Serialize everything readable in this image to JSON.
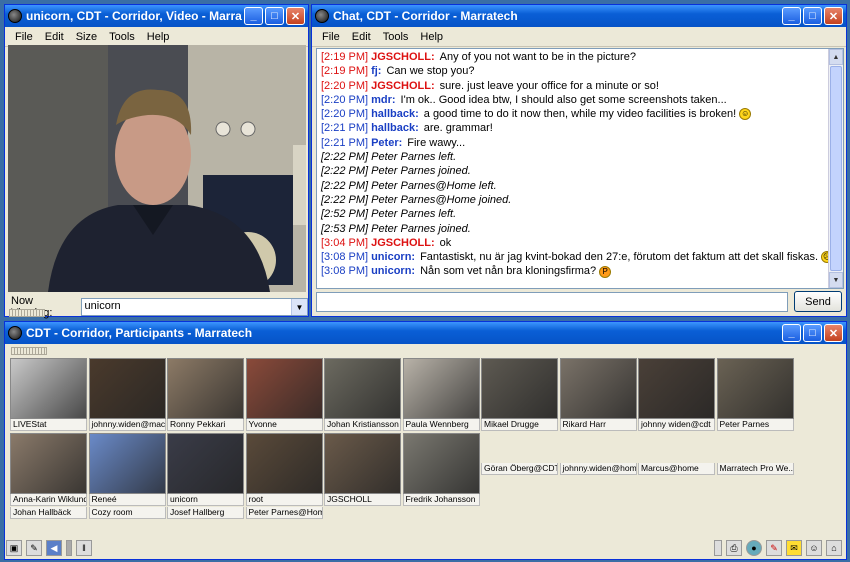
{
  "video_window": {
    "title": "unicorn, CDT - Corridor, Video - Marratech",
    "menu": [
      "File",
      "Edit",
      "Size",
      "Tools",
      "Help"
    ],
    "now_viewing_label": "Now Viewing:",
    "now_viewing_value": "unicorn"
  },
  "chat_window": {
    "title": "Chat, CDT - Corridor - Marratech",
    "menu": [
      "File",
      "Edit",
      "Tools",
      "Help"
    ],
    "send_label": "Send",
    "messages": [
      {
        "time": "[2:19 PM]",
        "time_color": "red",
        "nick": "JGSCHOLL:",
        "nick_color": "red",
        "text": "Any of you not want to be in the picture?"
      },
      {
        "time": "[2:19 PM]",
        "time_color": "red",
        "nick": "fj:",
        "nick_color": "blue",
        "text": "Can we stop you?"
      },
      {
        "time": "[2:20 PM]",
        "time_color": "red",
        "nick": "JGSCHOLL:",
        "nick_color": "red",
        "text": "sure.  just leave your office for a minute or so!"
      },
      {
        "time": "[2:20 PM]",
        "time_color": "blue",
        "nick": "mdr:",
        "nick_color": "blue",
        "text": "I'm ok.. Good idea btw, I should also get some screenshots taken..."
      },
      {
        "time": "[2:20 PM]",
        "time_color": "blue",
        "nick": "hallback:",
        "nick_color": "blue",
        "text": "a good time to do it now then, while my video facilities is broken!",
        "smiley": "smile"
      },
      {
        "time": "[2:21 PM]",
        "time_color": "blue",
        "nick": "hallback:",
        "nick_color": "blue",
        "text": "are. grammar!"
      },
      {
        "time": "[2:21 PM]",
        "time_color": "blue",
        "nick": "Peter:",
        "nick_color": "blue",
        "text": "Fire wawy..."
      },
      {
        "system": "[2:22 PM] Peter Parnes left."
      },
      {
        "system": "[2:22 PM] Peter Parnes joined."
      },
      {
        "system": "[2:22 PM] Peter Parnes@Home left."
      },
      {
        "system": "[2:22 PM] Peter Parnes@Home joined."
      },
      {
        "system": "[2:52 PM] Peter Parnes left."
      },
      {
        "system": "[2:53 PM] Peter Parnes joined."
      },
      {
        "time": "[3:04 PM]",
        "time_color": "red",
        "nick": "JGSCHOLL:",
        "nick_color": "red",
        "text": "ok"
      },
      {
        "time": "[3:08 PM]",
        "time_color": "blue",
        "nick": "unicorn:",
        "nick_color": "blue",
        "text": "Fantastiskt, nu är jag kvint-bokad den 27:e, förutom det faktum att det skall fiskas.",
        "smiley": "sad"
      },
      {
        "time": "[3:08 PM]",
        "time_color": "blue",
        "nick": "unicorn:",
        "nick_color": "blue",
        "text": "Nån som vet nån bra kloningsfirma?",
        "smiley": "tongue"
      }
    ]
  },
  "participants_window": {
    "title": "CDT - Corridor, Participants - Marratech",
    "row1": [
      {
        "name": "LIVEStat",
        "bg": "#c9c9c9"
      },
      {
        "name": "johnny.widen@mac",
        "bg": "#4a3a2c"
      },
      {
        "name": "Ronny Pekkari",
        "bg": "#8c7a66"
      },
      {
        "name": "Yvonne",
        "bg": "#8a4a3a"
      },
      {
        "name": "Johan Kristiansson",
        "bg": "#6c6a60"
      },
      {
        "name": "Paula Wennberg",
        "bg": "#b8b2a8"
      },
      {
        "name": "Mikael Drugge",
        "bg": "#5e5a52"
      },
      {
        "name": "Rikard Harr",
        "bg": "#7a7268"
      },
      {
        "name": "johnny widen@cdt",
        "bg": "#4a4038"
      },
      {
        "name": "Peter Parnes",
        "bg": "#6a6254"
      }
    ],
    "row2": [
      {
        "name": "Anna-Karin Wiklund",
        "bg": "#8a7a6a"
      },
      {
        "name": "Reneé",
        "bg": "#6a8ac8"
      },
      {
        "name": "unicorn",
        "bg": "#3a3c48"
      },
      {
        "name": "root",
        "bg": "#5a4a3a"
      },
      {
        "name": "JGSCHOLL",
        "bg": "#6a5a4a"
      },
      {
        "name": "Fredrik Johansson",
        "bg": "#7a7870"
      }
    ],
    "row2_noimg": [
      "Göran Öberg@CDT",
      "johnny.widen@home",
      "Marcus@home",
      "Marratech Pro We..."
    ],
    "row3": [
      "Johan Hallbäck",
      "Cozy room",
      "Josef Hallberg",
      "Peter Parnes@Home"
    ]
  }
}
